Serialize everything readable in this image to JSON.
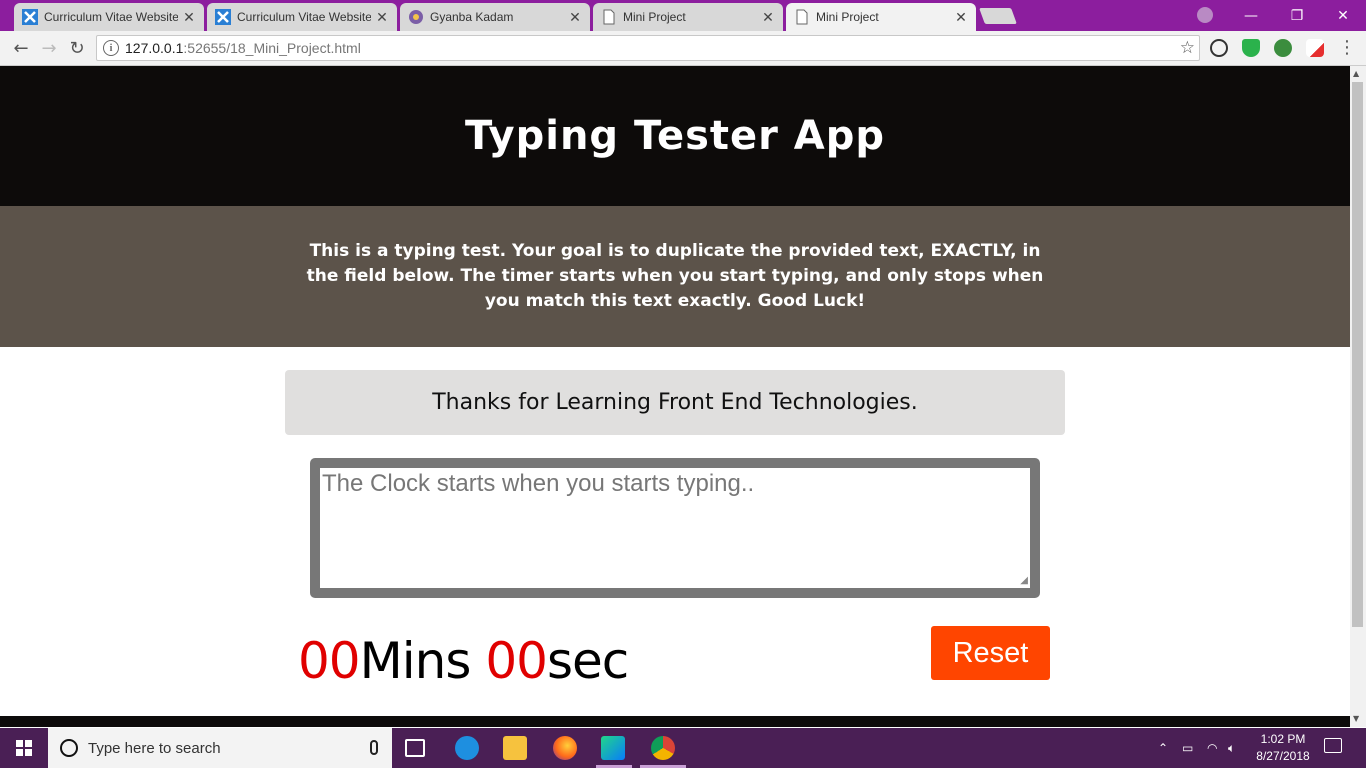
{
  "browser": {
    "tabs": [
      {
        "title": "Curriculum Vitae Website",
        "icon": "bracket-x-icon",
        "active": false
      },
      {
        "title": "Curriculum Vitae Website",
        "icon": "bracket-x-icon",
        "active": false
      },
      {
        "title": "Gyanba Kadam",
        "icon": "circle-logo-icon",
        "active": false
      },
      {
        "title": "Mini Project",
        "icon": "page-icon",
        "active": false
      },
      {
        "title": "Mini Project",
        "icon": "page-icon",
        "active": true
      }
    ],
    "close_glyph": "✕",
    "address": {
      "host": "127.0.0.1",
      "path": ":52655/18_Mini_Project.html"
    },
    "window_controls": {
      "minimize": "—",
      "maximize": "❐",
      "close": "✕"
    },
    "nav": {
      "back": "←",
      "forward": "→",
      "reload": "↻"
    },
    "star": "☆",
    "menu": "⋮",
    "info": "i"
  },
  "page": {
    "header_title": "Typing Tester App",
    "intro_text": "This is a typing test. Your goal is to duplicate the provided text, EXACTLY, in the field below. The timer starts when you start typing, and only stops when you match this text exactly. Good Luck!",
    "origin_text": "Thanks for Learning Front End Technologies.",
    "test_area": {
      "value": "",
      "placeholder": "The Clock starts when you starts typing.."
    },
    "timer": {
      "minutes": "00",
      "minutes_label": "Mins",
      "seconds": "00",
      "seconds_label": "sec"
    },
    "reset_label": "Reset"
  },
  "taskbar": {
    "search_placeholder": "Type here to search",
    "time": "1:02 PM",
    "date": "8/27/2018",
    "pinned": [
      "task-view-icon",
      "edge-icon",
      "file-explorer-icon",
      "firefox-icon",
      "webstorm-icon",
      "chrome-icon"
    ]
  },
  "colors": {
    "tab_strip": "#8c1e9e",
    "header_bg": "#0d0b0a",
    "intro_bg": "#5c534a",
    "timer_digits": "#e00000",
    "reset_bg": "#ff4500",
    "taskbar_bg": "#4a1f55"
  }
}
